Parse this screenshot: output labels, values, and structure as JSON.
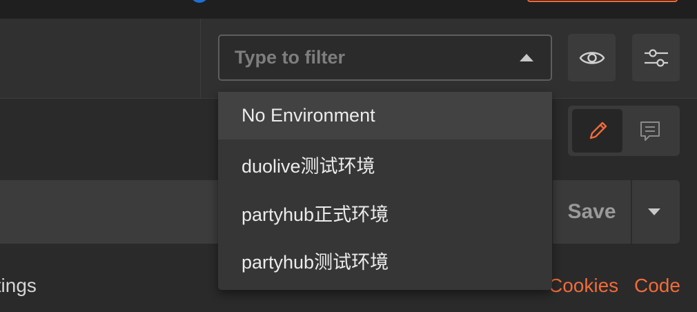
{
  "environment": {
    "filter": {
      "placeholder": "Type to filter",
      "value": ""
    },
    "options": [
      "No Environment",
      "duolive测试环境",
      "partyhub正式环境",
      "partyhub测试环境"
    ],
    "highlighted_index": 0
  },
  "toolbar": {
    "eye_icon": "eye-icon",
    "settings_icon": "sliders-icon"
  },
  "request": {
    "save_label": "Save",
    "edit_icon": "pencil-icon",
    "comment_icon": "comment-icon"
  },
  "links": {
    "settings": "ttings",
    "cookies": "Cookies",
    "code": "Code"
  },
  "colors": {
    "accent": "#f26b3a",
    "background": "#2a2a2a",
    "dropdown_bg": "#363636",
    "highlight_bg": "#424242"
  }
}
